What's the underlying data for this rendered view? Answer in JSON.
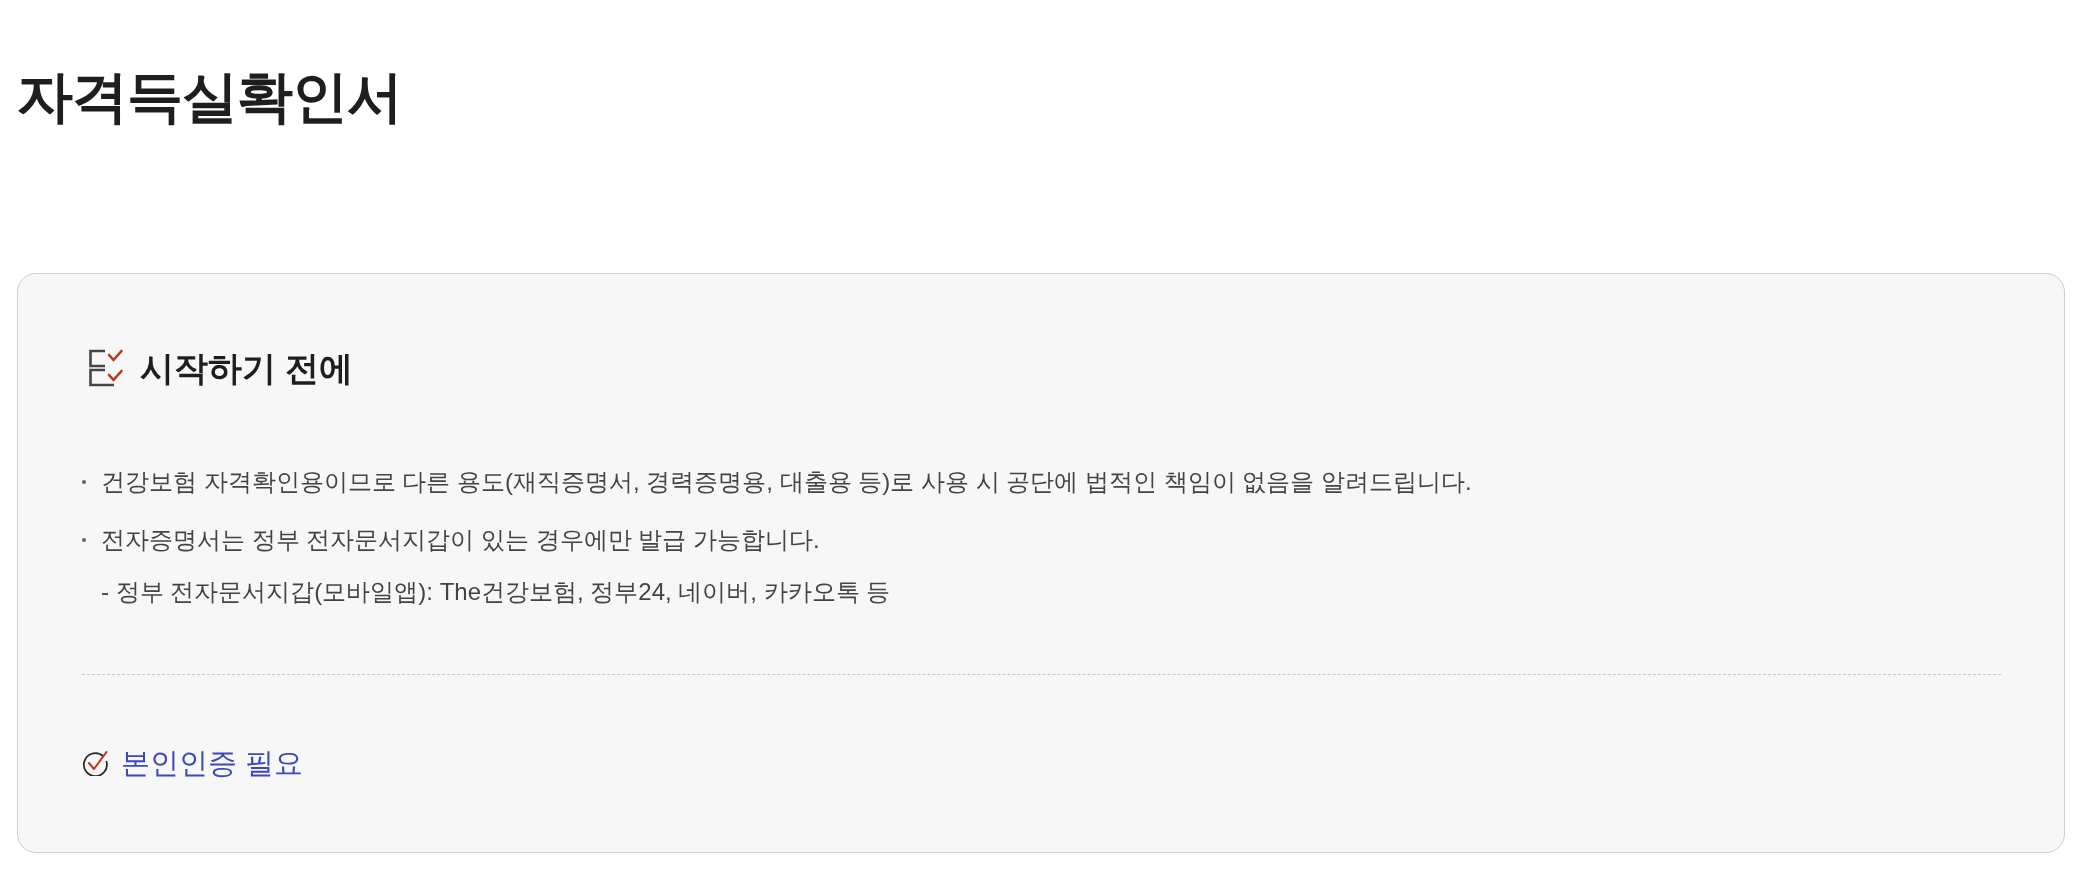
{
  "page_title": "자격득실확인서",
  "notice_card": {
    "heading": "시작하기 전에",
    "items": [
      {
        "text": "건강보험 자격확인용이므로 다른 용도(재직증명서, 경력증명용, 대출용 등)로 사용 시 공단에 법적인 책임이 없음을 알려드립니다."
      },
      {
        "text": "전자증명서는 정부 전자문서지갑이 있는 경우에만 발급 가능합니다.",
        "children": [
          {
            "text": "- 정부 전자문서지갑(모바일앱): The건강보험, 정부24, 네이버, 카카오톡 등"
          }
        ]
      }
    ],
    "requirement": "본인인증 필요"
  }
}
